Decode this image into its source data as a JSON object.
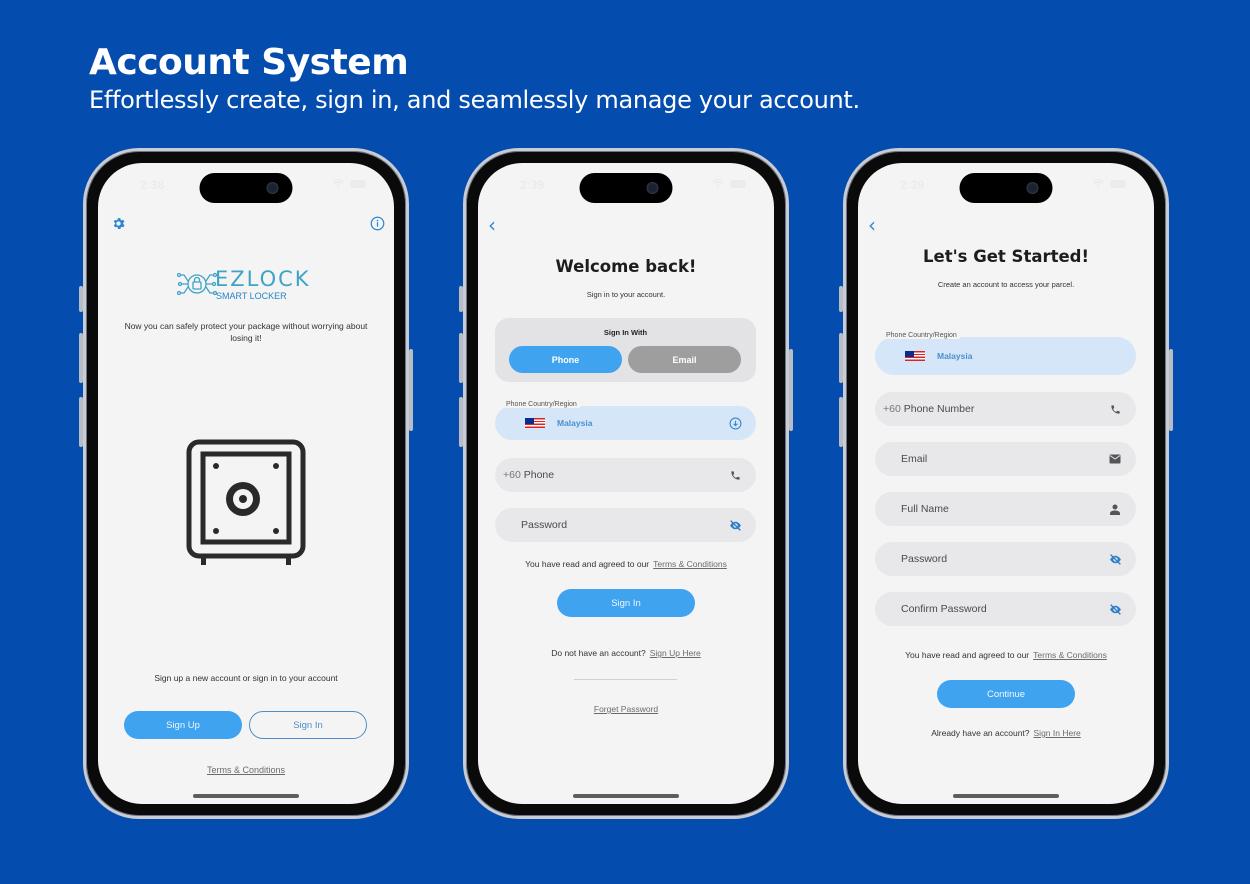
{
  "hero": {
    "title": "Account System",
    "subtitle": "Effortlessly create, sign in, and seamlessly manage your account."
  },
  "colors": {
    "background": "#044cae",
    "primary": "#40a3f0",
    "country_field": "#d4e6f7",
    "input": "#e8e8ea",
    "secondary_button": "#9e9e9e"
  },
  "welcome_screen": {
    "status_time": "2:38",
    "settings_icon": "gear-icon",
    "info_icon": "info-circle-icon",
    "logo": {
      "brand": "EZLOCK",
      "tagline": "SMART LOCKER"
    },
    "description": "Now you can safely protect your package without worrying about losing it!",
    "illustration": "safe-icon",
    "prompt": "Sign up a new account or sign in to your account",
    "sign_up_label": "Sign Up",
    "sign_in_label": "Sign In",
    "terms_link": "Terms & Conditions"
  },
  "sign_in_screen": {
    "status_time": "2:39",
    "title": "Welcome back!",
    "subtitle": "Sign in to your account.",
    "sign_in_with": {
      "label": "Sign In With",
      "options": [
        "Phone",
        "Email"
      ],
      "selected": "Phone"
    },
    "country_field": {
      "label": "Phone Country/Region",
      "value": "Malaysia"
    },
    "phone_field": {
      "prefix": "+60",
      "placeholder": "Phone"
    },
    "password_field": {
      "placeholder": "Password"
    },
    "agree_text": "You have read and agreed to our",
    "terms_link": "Terms & Conditions",
    "submit_label": "Sign In",
    "no_account_text": "Do not have an account?",
    "sign_up_link": "Sign Up Here",
    "forgot_link": "Forget Password"
  },
  "sign_up_screen": {
    "status_time": "2:39",
    "title": "Let's Get Started!",
    "subtitle": "Create an account to access your parcel.",
    "country_field": {
      "label": "Phone Country/Region",
      "value": "Malaysia"
    },
    "fields": [
      {
        "prefix": "+60",
        "placeholder": "Phone Number",
        "icon": "phone-icon"
      },
      {
        "placeholder": "Email",
        "icon": "mail-icon"
      },
      {
        "placeholder": "Full Name",
        "icon": "person-icon"
      },
      {
        "placeholder": "Password",
        "icon": "eye-off-icon"
      },
      {
        "placeholder": "Confirm Password",
        "icon": "eye-off-icon"
      }
    ],
    "agree_text": "You have read and agreed to our",
    "terms_link": "Terms & Conditions",
    "submit_label": "Continue",
    "have_account_text": "Already have an account?",
    "sign_in_link": "Sign In Here"
  }
}
